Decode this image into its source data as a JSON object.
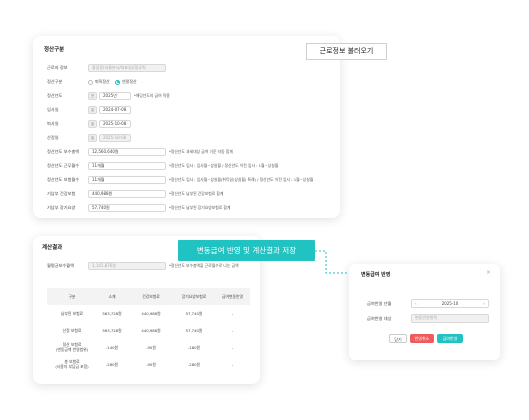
{
  "settlement": {
    "title": "정산구분",
    "employee_label": "근로자 정보",
    "employee_value": "홍길동(서울본사/대표실)/정규직",
    "type_label": "정산구분",
    "type_options": [
      "퇴직정산",
      "연말정산"
    ],
    "type_selected": "연말정산",
    "year_label": "정산년도",
    "year_cap": "연",
    "year_value": "2025년",
    "year_note": "*해당년도의 급여 적용",
    "join_label": "입사일",
    "join_cap": "일",
    "join_value": "2024-07-08",
    "leave_label": "퇴사일",
    "leave_cap": "일",
    "leave_value": "2025-10-08",
    "calc_label": "산정일",
    "calc_cap": "일",
    "calc_value": "2025-10-08",
    "wage_label": "정산년도 보수총액",
    "wage_value": "12,560,640원",
    "wage_note": "*정산년도 과세대상 급여 기준 자동 합계",
    "months_label": "정산년도 근무월수",
    "months_value": "11개월",
    "months_note": "*정산년도 입사 : 입사월~상실월 / 정산년도 이전 입사 : 1월~상실월",
    "ins_months_label": "정산년도 보험월수",
    "ins_months_value": "11개월",
    "ins_months_note": "*정산년도 입사 : 입사월~상실월(취득일(상실월) 특례) / 정산년도 이전 입사 : 1월~상실월",
    "health_label": "기납부 건강보험",
    "health_value": "440,988원",
    "health_note": "*정산년도 납부된 건강보험료 합계",
    "ltc_label": "기납부 장기요양",
    "ltc_value": "57,740원",
    "ltc_note": "*정산년도 납부된 장기요양보험료 합계"
  },
  "result": {
    "title": "계산결과",
    "monthly_label": "월평균보수월액",
    "monthly_value": "1,141,876원",
    "monthly_note": "*정산년도 보수총액을 근로월수로 나눈 금액",
    "headers": [
      "구분",
      "소계",
      "건강보험료",
      "장기요양보험료",
      "급여변동반영"
    ],
    "rows": [
      {
        "cat": "납부된 보험료",
        "sub": "563,728원",
        "health": "440,988원",
        "ltc": "57,740원",
        "reflect": "-"
      },
      {
        "cat": "산정 보험료",
        "sub": "563,728원",
        "health": "440,988원",
        "ltc": "57,740원",
        "reflect": "-"
      },
      {
        "cat": "정산 보험료",
        "cat2": "(변동금액 반영범위)",
        "sub": "-140원",
        "health": "-90원",
        "ltc": "-180원",
        "reflect": "-"
      },
      {
        "cat": "총 보험료",
        "cat2": "(사용자 부담금 포함)",
        "sub": "-280원",
        "health": "-90원",
        "ltc": "-280원",
        "reflect": "-"
      }
    ]
  },
  "callouts": {
    "load_label": "근로정보 불러오기",
    "save_label": "변동급여 반영 및 계산결과 저장"
  },
  "popup": {
    "title": "변동급여 반영",
    "month_label": "급여반영 년월",
    "month_value": "2025-10",
    "target_label": "급여반영 대상",
    "target_placeholder": "변동반영항목",
    "btn_close": "닫기",
    "btn_cancel": "반영취소",
    "btn_apply": "급여반영"
  },
  "colors": {
    "accent": "#21c2c2",
    "danger": "#ef5a5a"
  }
}
